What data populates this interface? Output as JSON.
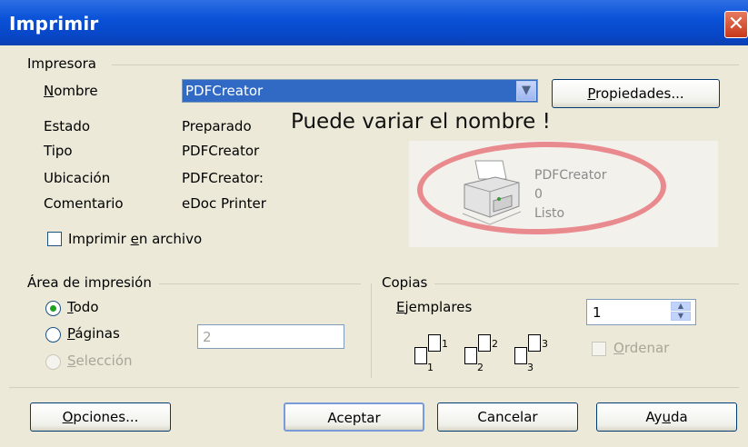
{
  "window": {
    "title": "Imprimir"
  },
  "printer": {
    "group_label": "Impresora",
    "name_label": "Nombre",
    "name_value": "PDFCreator",
    "properties_button": "Propiedades...",
    "status_label": "Estado",
    "status_value": "Preparado",
    "type_label": "Tipo",
    "type_value": "PDFCreator",
    "location_label": "Ubicación",
    "location_value": "PDFCreator:",
    "comment_label": "Comentario",
    "comment_value": "eDoc Printer",
    "annotation": "Puede variar el nombre !",
    "preview": {
      "name": "PDFCreator",
      "jobs": "0",
      "state": "Listo"
    },
    "print_to_file_label": "Imprimir en archivo",
    "print_to_file_checked": false
  },
  "print_range": {
    "group_label": "Área de impresión",
    "all_label": "Todo",
    "pages_label": "Páginas",
    "pages_value": "2",
    "selection_label": "Selección"
  },
  "copies": {
    "group_label": "Copias",
    "count_label": "Ejemplares",
    "count_value": "1",
    "collate_label": "Ordenar",
    "page_icons": [
      [
        "1",
        "1"
      ],
      [
        "2",
        "2"
      ],
      [
        "3",
        "3"
      ]
    ]
  },
  "buttons": {
    "options": "Opciones...",
    "ok": "Aceptar",
    "cancel": "Cancelar",
    "help": "Ayuda"
  }
}
